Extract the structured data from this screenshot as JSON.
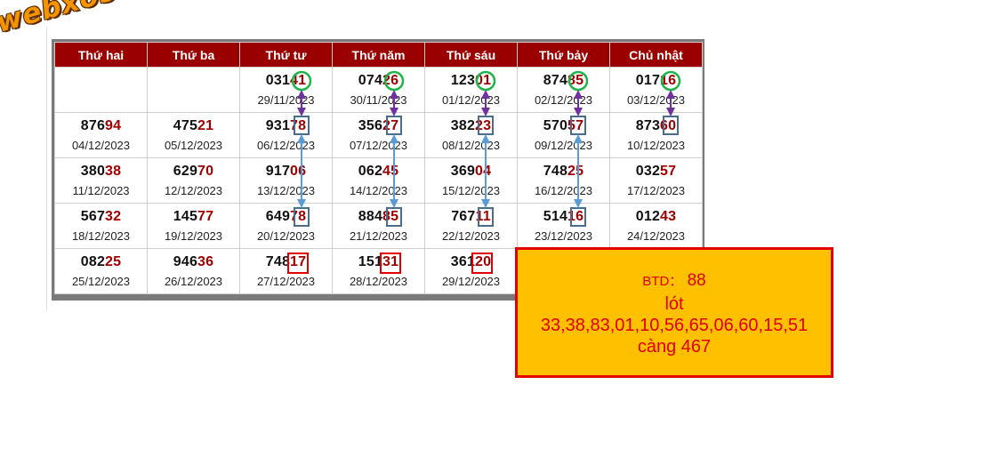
{
  "watermark": "webxoso.net",
  "headers": [
    "Thứ hai",
    "Thứ ba",
    "Thứ tư",
    "Thứ năm",
    "Thứ sáu",
    "Thứ bảy",
    "Chủ nhật"
  ],
  "rows": [
    [
      {
        "n": "",
        "h": "",
        "d": "",
        "c": "white"
      },
      {
        "n": "",
        "h": "",
        "d": "",
        "c": "white"
      },
      {
        "n": "031",
        "h": "41",
        "d": "29/11/2023",
        "c": "white"
      },
      {
        "n": "074",
        "h": "26",
        "d": "30/11/2023",
        "c": "white"
      },
      {
        "n": "123",
        "h": "01",
        "d": "01/12/2023",
        "c": "white"
      },
      {
        "n": "874",
        "h": "85",
        "d": "02/12/2023",
        "c": "green"
      },
      {
        "n": "017",
        "h": "16",
        "d": "03/12/2023",
        "c": "green"
      }
    ],
    [
      {
        "n": "876",
        "h": "94",
        "d": "04/12/2023",
        "c": "white"
      },
      {
        "n": "475",
        "h": "21",
        "d": "05/12/2023",
        "c": "white"
      },
      {
        "n": "931",
        "h": "78",
        "d": "06/12/2023",
        "c": "orange"
      },
      {
        "n": "356",
        "h": "27",
        "d": "07/12/2023",
        "c": "orange"
      },
      {
        "n": "382",
        "h": "23",
        "d": "08/12/2023",
        "c": "orange"
      },
      {
        "n": "570",
        "h": "57",
        "d": "09/12/2023",
        "c": "orange"
      },
      {
        "n": "873",
        "h": "60",
        "d": "10/12/2023",
        "c": "green"
      }
    ],
    [
      {
        "n": "380",
        "h": "38",
        "d": "11/12/2023",
        "c": "white"
      },
      {
        "n": "629",
        "h": "70",
        "d": "12/12/2023",
        "c": "white"
      },
      {
        "n": "917",
        "h": "06",
        "d": "13/12/2023",
        "c": "white"
      },
      {
        "n": "062",
        "h": "45",
        "d": "14/12/2023",
        "c": "white"
      },
      {
        "n": "369",
        "h": "04",
        "d": "15/12/2023",
        "c": "white"
      },
      {
        "n": "748",
        "h": "25",
        "d": "16/12/2023",
        "c": "green"
      },
      {
        "n": "032",
        "h": "57",
        "d": "17/12/2023",
        "c": "green"
      }
    ],
    [
      {
        "n": "567",
        "h": "32",
        "d": "18/12/2023",
        "c": "white"
      },
      {
        "n": "145",
        "h": "77",
        "d": "19/12/2023",
        "c": "white"
      },
      {
        "n": "649",
        "h": "78",
        "d": "20/12/2023",
        "c": "orange"
      },
      {
        "n": "884",
        "h": "85",
        "d": "21/12/2023",
        "c": "orange"
      },
      {
        "n": "767",
        "h": "11",
        "d": "22/12/2023",
        "c": "orange"
      },
      {
        "n": "514",
        "h": "16",
        "d": "23/12/2023",
        "c": "orange"
      },
      {
        "n": "012",
        "h": "43",
        "d": "24/12/2023",
        "c": "green"
      }
    ],
    [
      {
        "n": "082",
        "h": "25",
        "d": "25/12/2023",
        "c": "white"
      },
      {
        "n": "946",
        "h": "36",
        "d": "26/12/2023",
        "c": "white"
      },
      {
        "n": "748",
        "h": "17",
        "d": "27/12/2023",
        "c": "white"
      },
      {
        "n": "151",
        "h": "31",
        "d": "28/12/2023",
        "c": "white"
      },
      {
        "n": "361",
        "h": "20",
        "d": "29/12/2023",
        "c": "white"
      },
      {
        "n": "",
        "h": "",
        "d": "",
        "c": "white"
      },
      {
        "n": "",
        "h": "",
        "d": "",
        "c": "white"
      }
    ]
  ],
  "prediction": {
    "btd_label": "BTD：",
    "btd_value": "88",
    "lot_label": "lót",
    "lot_numbers": "33,38,83,01,10,56,65,06,60,15,51",
    "cang": "càng 467"
  },
  "colors": {
    "header_bg": "#9b0000",
    "orange_cell": "#ffc000",
    "green_cell": "#e2efda",
    "highlight_digit": "#a00000",
    "circle": "#1db548",
    "arrow_purple": "#7030a0",
    "arrow_blue": "#5b9bd5",
    "box_blue": "#4a6d8c",
    "box_red": "#e00000"
  }
}
